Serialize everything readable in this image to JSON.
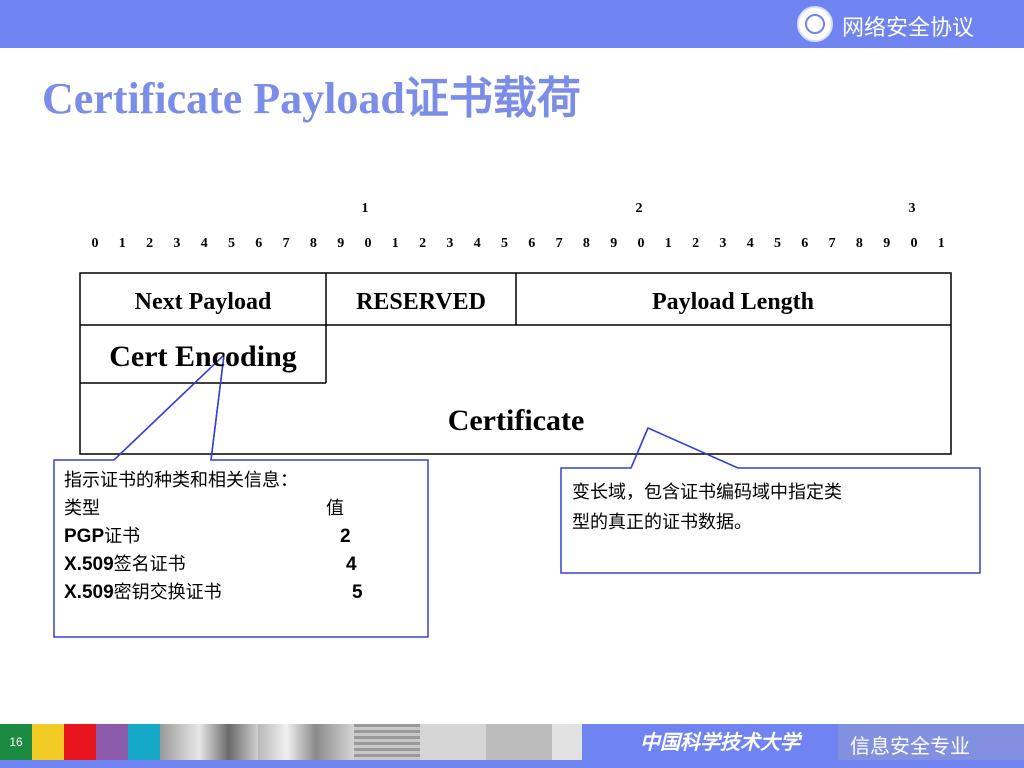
{
  "header": {
    "course_title": "网络安全协议"
  },
  "slide": {
    "title_en": "Certificate Payload",
    "title_cn": "证书载荷"
  },
  "bit_scale": {
    "tens": [
      "1",
      "2",
      "3"
    ],
    "units": [
      "0",
      "1",
      "2",
      "3",
      "4",
      "5",
      "6",
      "7",
      "8",
      "9",
      "0",
      "1",
      "2",
      "3",
      "4",
      "5",
      "6",
      "7",
      "8",
      "9",
      "0",
      "1",
      "2",
      "3",
      "4",
      "5",
      "6",
      "7",
      "8",
      "9",
      "0",
      "1"
    ]
  },
  "payload_table": {
    "next_payload": "Next Payload",
    "reserved": "RESERVED",
    "payload_length": "Payload Length",
    "cert_encoding": "Cert Encoding",
    "certificate": "Certificate"
  },
  "callout_left": {
    "heading": "指示证书的种类和相关信息：",
    "col_type": "类型",
    "col_value": "值",
    "rows": [
      {
        "type_bold": "PGP",
        "type_rest": "证书",
        "value": "2"
      },
      {
        "type_bold": "X.509",
        "type_rest": "签名证书",
        "value": "4"
      },
      {
        "type_bold": "X.509",
        "type_rest": "密钥交换证书",
        "value": "5"
      }
    ]
  },
  "callout_right": {
    "line1": "变长域，包含证书编码域中指定类",
    "line2": "型的真正的证书数据。"
  },
  "footer": {
    "page_number": "16",
    "university": "中国科学技术大学",
    "major": "信息安全专业"
  },
  "colors": {
    "bar_blue": "#6f84f0",
    "title_blue": "#7b8de6",
    "callout_border": "#3344cc"
  }
}
